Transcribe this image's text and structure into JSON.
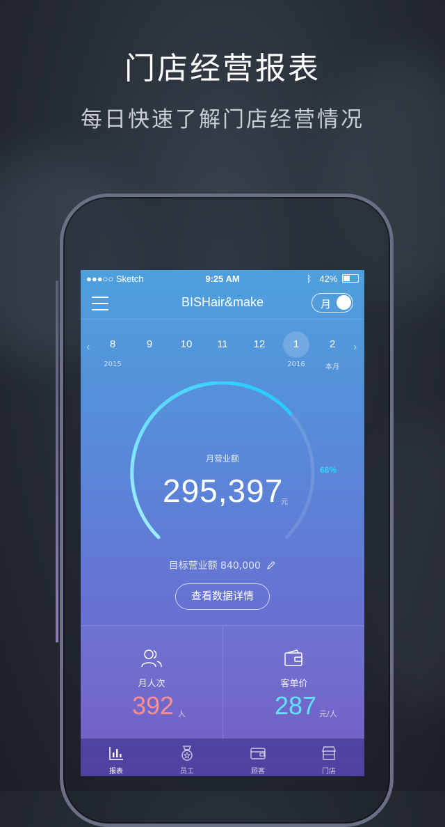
{
  "promo": {
    "title": "门店经营报表",
    "subtitle": "每日快速了解门店经营情况"
  },
  "status_bar": {
    "carrier": "●●●○○ Sketch",
    "time": "9:25 AM",
    "battery": "42%"
  },
  "nav": {
    "title": "BISHair&make",
    "toggle_label": "月"
  },
  "months": [
    {
      "num": "8",
      "year": "2015"
    },
    {
      "num": "9",
      "year": ""
    },
    {
      "num": "10",
      "year": ""
    },
    {
      "num": "11",
      "year": ""
    },
    {
      "num": "12",
      "year": ""
    },
    {
      "num": "1",
      "year": "2016"
    },
    {
      "num": "2",
      "year": "本月"
    }
  ],
  "gauge": {
    "label": "月营业额",
    "value": "295,397",
    "unit": "元",
    "percent_text": "68%",
    "progress": 0.68,
    "target_label": "目标营业额",
    "target_value": "840,000",
    "accent": "#2cd6ff"
  },
  "detail_button": "查看数据详情",
  "stats": {
    "visits_label": "月人次",
    "visits_value": "392",
    "visits_unit": "人",
    "visits_color": "#ff8f8f",
    "price_label": "客单价",
    "price_value": "287",
    "price_unit": "元/人",
    "price_color": "#5fe3ff"
  },
  "tabs": [
    {
      "label": "报表",
      "icon": "bar-chart-icon"
    },
    {
      "label": "员工",
      "icon": "medal-icon"
    },
    {
      "label": "顾客",
      "icon": "wallet-icon"
    },
    {
      "label": "门店",
      "icon": "store-icon"
    }
  ]
}
